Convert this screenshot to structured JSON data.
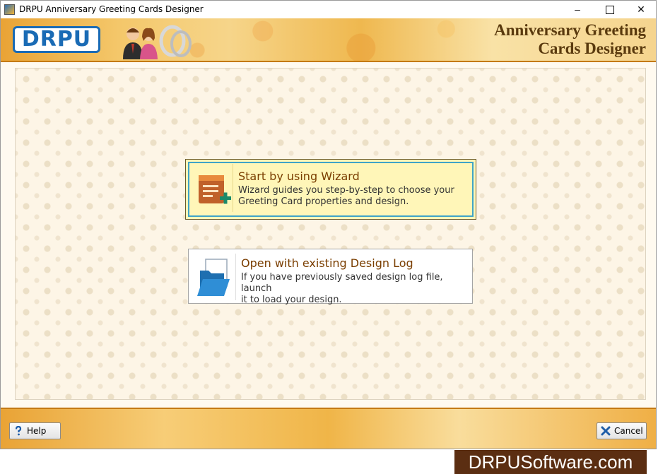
{
  "window": {
    "title": "DRPU Anniversary Greeting Cards Designer",
    "controls": {
      "minimize": "–",
      "close": "✕"
    }
  },
  "header": {
    "logo_text": "DRPU",
    "heading_line1": "Anniversary Greeting",
    "heading_line2": "Cards Designer"
  },
  "options": [
    {
      "title": "Start by using Wizard",
      "desc_line1": "Wizard guides you step-by-step to choose your",
      "desc_line2": "Greeting Card properties and design.",
      "icon": "wizard-icon",
      "selected": true
    },
    {
      "title": "Open with existing Design Log",
      "desc_line1": "If you have previously saved design log file, launch",
      "desc_line2": "it to load your design.",
      "icon": "folder-open-icon",
      "selected": false
    }
  ],
  "footer": {
    "help_label": "Help",
    "cancel_label": "Cancel"
  },
  "watermark": "DRPUSoftware.com",
  "colors": {
    "accent": "#1a6bb5",
    "banner": "#f0b548",
    "selected_bg": "#fff6b8",
    "selected_border": "#3fa4c8",
    "title_text": "#7a3e00"
  }
}
